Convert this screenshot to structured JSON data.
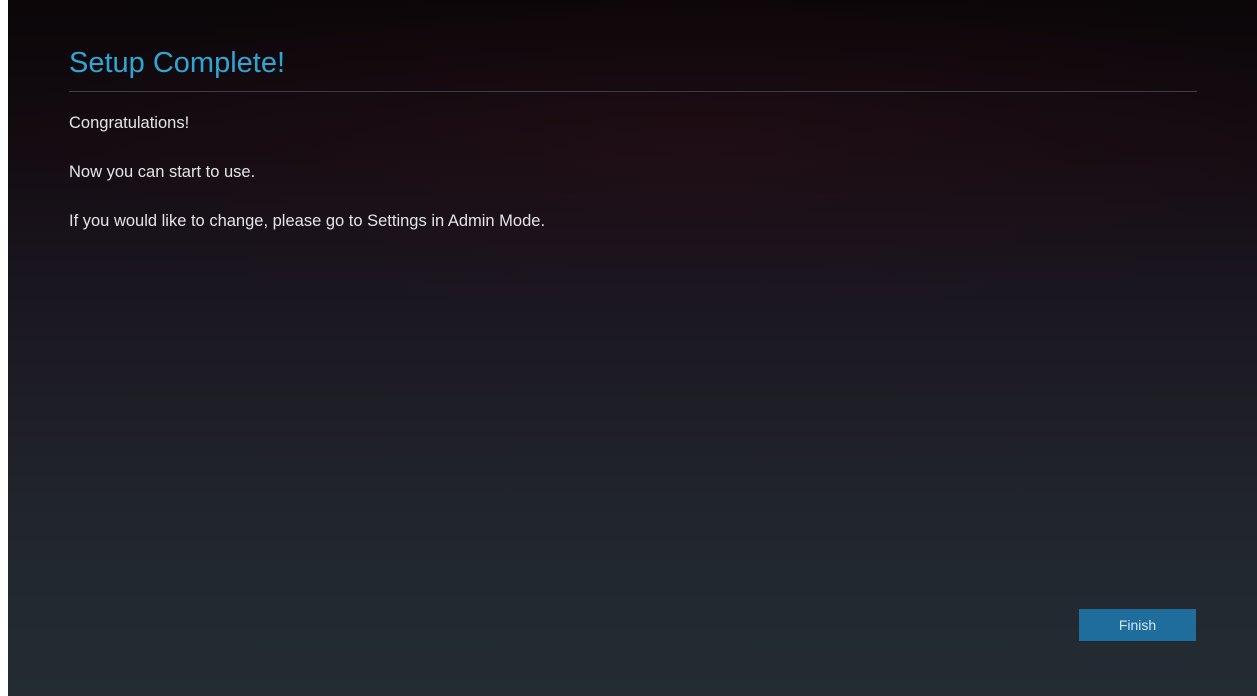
{
  "dialog": {
    "title": "Setup Complete!",
    "lines": [
      "Congratulations!",
      "Now you can start to use.",
      "If you would like to change, please go to Settings in Admin Mode."
    ],
    "finish_label": "Finish"
  },
  "colors": {
    "title": "#2fa5d6",
    "button": "#1e6d9c"
  }
}
